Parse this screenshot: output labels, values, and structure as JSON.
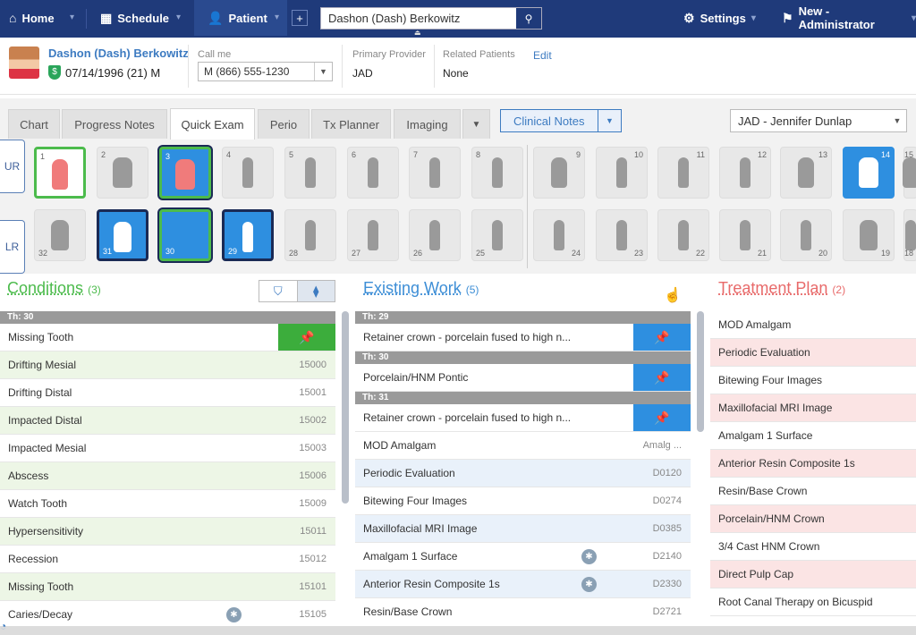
{
  "nav": {
    "home": "Home",
    "schedule": "Schedule",
    "patient": "Patient",
    "search_value": "Dashon (Dash) Berkowitz",
    "settings": "Settings",
    "location": "New - Administrator"
  },
  "patient": {
    "name": "Dashon (Dash) Berkowitz",
    "dob": "07/14/1996 (21) M",
    "call_me_label": "Call me",
    "phone": "M (866) 555-1230",
    "primary_provider_label": "Primary Provider",
    "primary_provider": "JAD",
    "related_label": "Related Patients",
    "related": "None",
    "edit": "Edit"
  },
  "tabs": [
    "Chart",
    "Progress Notes",
    "Quick Exam",
    "Perio",
    "Tx Planner",
    "Imaging"
  ],
  "clinical_notes": "Clinical Notes",
  "provider_select": "JAD - Jennifer Dunlap",
  "arches": {
    "upper": "UR",
    "lower": "LR"
  },
  "upper_teeth": [
    "1",
    "2",
    "3",
    "4",
    "5",
    "6",
    "7",
    "8",
    "9",
    "10",
    "11",
    "12",
    "13",
    "14",
    "15"
  ],
  "lower_teeth": [
    "32",
    "31",
    "30",
    "29",
    "28",
    "27",
    "26",
    "25",
    "24",
    "23",
    "22",
    "21",
    "20",
    "19",
    "18"
  ],
  "conditions": {
    "title": "Conditions",
    "count": "(3)",
    "group": "Th:    30",
    "rows": [
      {
        "name": "Missing Tooth",
        "code": ""
      },
      {
        "name": "Drifting Mesial",
        "code": "15000"
      },
      {
        "name": "Drifting Distal",
        "code": "15001"
      },
      {
        "name": "Impacted Distal",
        "code": "15002"
      },
      {
        "name": "Impacted Mesial",
        "code": "15003"
      },
      {
        "name": "Abscess",
        "code": "15006"
      },
      {
        "name": "Watch Tooth",
        "code": "15009"
      },
      {
        "name": "Hypersensitivity",
        "code": "15011"
      },
      {
        "name": "Recession",
        "code": "15012"
      },
      {
        "name": "Missing Tooth",
        "code": "15101"
      },
      {
        "name": "Caries/Decay",
        "code": "15105"
      }
    ]
  },
  "existing": {
    "title": "Existing Work",
    "count": "(5)",
    "groups": [
      {
        "th": "Th:    29",
        "item": "Retainer crown - porcelain fused to high n..."
      },
      {
        "th": "Th:    30",
        "item": "Porcelain/HNM Pontic"
      },
      {
        "th": "Th:    31",
        "item": "Retainer crown - porcelain fused to high n..."
      }
    ],
    "rows": [
      {
        "name": "MOD Amalgam",
        "code": "Amalg ..."
      },
      {
        "name": "Periodic Evaluation",
        "code": "D0120"
      },
      {
        "name": "Bitewing Four Images",
        "code": "D0274"
      },
      {
        "name": "Maxillofacial MRI Image",
        "code": "D0385"
      },
      {
        "name": "Amalgam 1 Surface",
        "code": "D2140"
      },
      {
        "name": "Anterior Resin Composite 1s",
        "code": "D2330"
      },
      {
        "name": "Resin/Base Crown",
        "code": "D2721"
      }
    ]
  },
  "treatment": {
    "title": "Treatment Plan",
    "count": "(2)",
    "rows": [
      "MOD Amalgam",
      "Periodic Evaluation",
      "Bitewing Four Images",
      "Maxillofacial MRI Image",
      "Amalgam 1 Surface",
      "Anterior Resin Composite 1s",
      "Resin/Base Crown",
      "Porcelain/HNM Crown",
      "3/4 Cast HNM Crown",
      "Direct Pulp Cap",
      "Root Canal Therapy on Bicuspid"
    ]
  },
  "colors": {
    "nav_bg": "#1f3a7a",
    "accent_blue": "#2e8fe0",
    "conditions_green": "#4cbb4c",
    "treatment_red": "#e86a6a"
  }
}
